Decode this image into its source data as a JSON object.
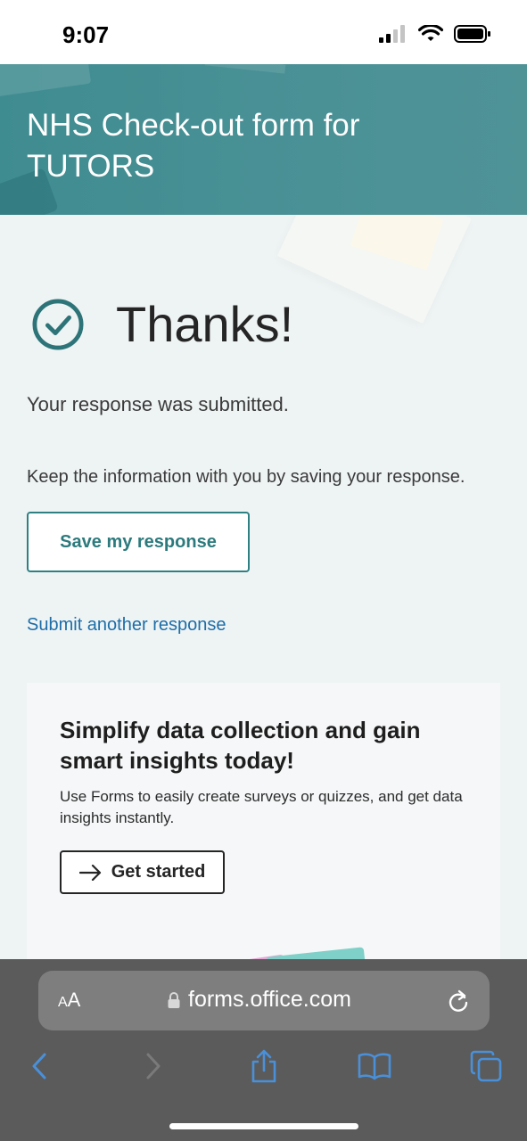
{
  "status_bar": {
    "time": "9:07"
  },
  "header": {
    "title": "NHS Check-out form for TUTORS"
  },
  "confirmation": {
    "thanks": "Thanks!",
    "submitted": "Your response was submitted.",
    "keep_info": "Keep the information with you by saving your response.",
    "save_label": "Save my response",
    "submit_another_label": "Submit another response"
  },
  "promo": {
    "title": "Simplify data collection and gain smart insights today!",
    "description": "Use Forms to easily create surveys or quizzes, and get data insights instantly.",
    "get_started_label": "Get started"
  },
  "browser": {
    "text_size_label_small": "A",
    "text_size_label_large": "A",
    "url": "forms.office.com",
    "toolbar_icons": [
      "back-icon",
      "forward-icon",
      "share-icon",
      "bookmarks-icon",
      "tabs-icon"
    ]
  },
  "colors": {
    "header_bg": "#4a9196",
    "accent": "#2e8083",
    "link": "#1d6ea8",
    "browser_bg": "#5b5b5b",
    "toolbar_icon": "#4a90d9"
  }
}
